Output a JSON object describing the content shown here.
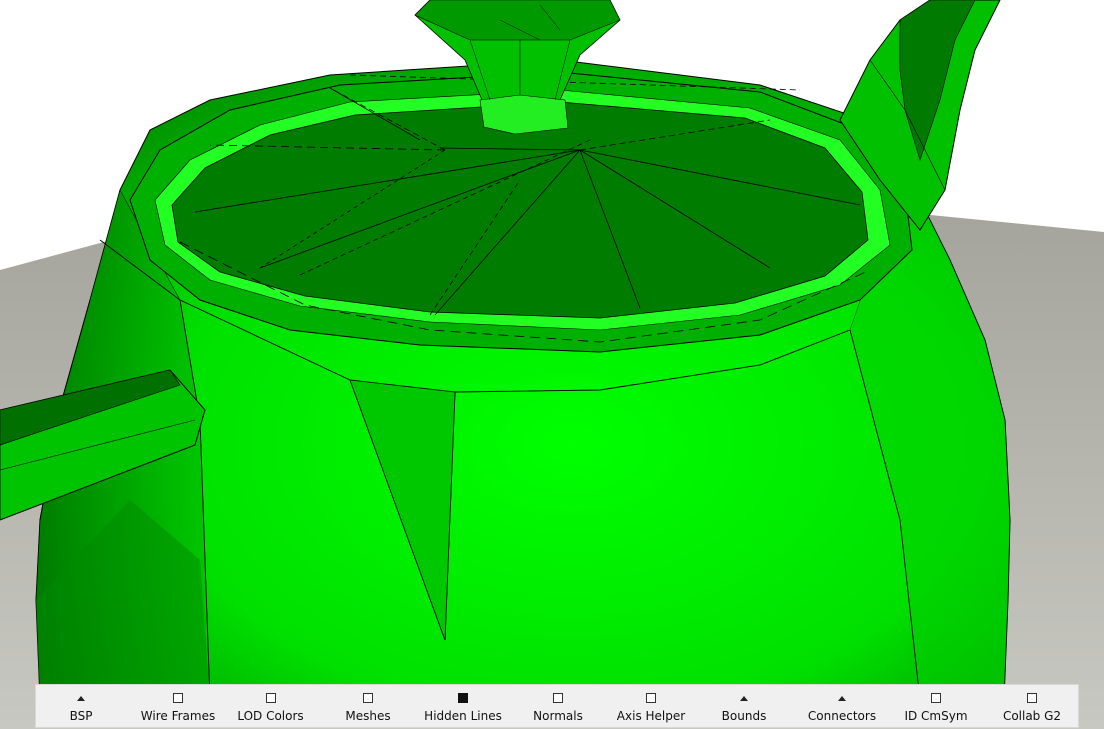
{
  "toolbar": {
    "items": [
      {
        "label": "BSP",
        "indicator": "arrow",
        "checked": false
      },
      {
        "label": "Wire Frames",
        "indicator": "checkbox",
        "checked": false
      },
      {
        "label": "LOD Colors",
        "indicator": "checkbox",
        "checked": false
      },
      {
        "label": "Meshes",
        "indicator": "checkbox",
        "checked": false
      },
      {
        "label": "Hidden Lines",
        "indicator": "checkbox",
        "checked": true
      },
      {
        "label": "Normals",
        "indicator": "checkbox",
        "checked": false
      },
      {
        "label": "Axis Helper",
        "indicator": "checkbox",
        "checked": false
      },
      {
        "label": "Bounds",
        "indicator": "arrow",
        "checked": false
      },
      {
        "label": "Connectors",
        "indicator": "arrow",
        "checked": false
      },
      {
        "label": "ID CmSym",
        "indicator": "checkbox",
        "checked": false
      },
      {
        "label": "Collab G2",
        "indicator": "checkbox",
        "checked": false
      }
    ]
  },
  "scene": {
    "model_color": "#00e600",
    "floor_color": "#a8a8a0"
  }
}
